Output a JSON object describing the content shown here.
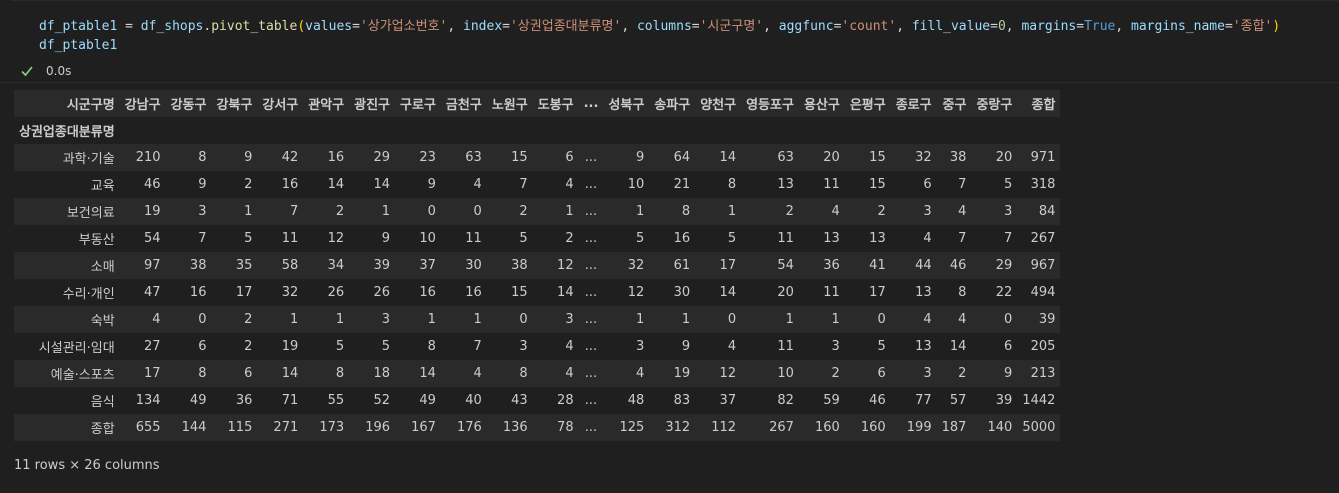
{
  "code": {
    "line1_var": "df_ptable1",
    "line1_assign": " = ",
    "line1_obj": "df_shops",
    "line1_method": ".pivot_table",
    "line1_open": "(",
    "arg_values_key": "values",
    "arg_values_val": "'상가업소번호'",
    "arg_index_key": "index",
    "arg_index_val": "'상권업종대분류명'",
    "arg_columns_key": "columns",
    "arg_columns_val": "'시군구명'",
    "arg_aggfunc_key": "aggfunc",
    "arg_aggfunc_val": "'count'",
    "arg_fill_key": "fill_value",
    "arg_fill_val": "0",
    "arg_margins_key": "margins",
    "arg_margins_val": "True",
    "arg_mname_key": "margins_name",
    "arg_mname_val": "'종합'",
    "line1_close": ")",
    "line2": "df_ptable1"
  },
  "exec": {
    "time": "0.0s",
    "status_color": "#89d185"
  },
  "table": {
    "columns_name": "시군구명",
    "index_name": "상권업종대분류명",
    "columns": [
      "강남구",
      "강동구",
      "강북구",
      "강서구",
      "관악구",
      "광진구",
      "구로구",
      "금천구",
      "노원구",
      "도봉구",
      "...",
      "성북구",
      "송파구",
      "양천구",
      "영등포구",
      "용산구",
      "은평구",
      "종로구",
      "중구",
      "중랑구",
      "종합"
    ],
    "rows": [
      {
        "label": "과학·기술",
        "values": [
          "210",
          "8",
          "9",
          "42",
          "16",
          "29",
          "23",
          "63",
          "15",
          "6",
          "...",
          "9",
          "64",
          "14",
          "63",
          "20",
          "15",
          "32",
          "38",
          "20",
          "971"
        ]
      },
      {
        "label": "교육",
        "values": [
          "46",
          "9",
          "2",
          "16",
          "14",
          "14",
          "9",
          "4",
          "7",
          "4",
          "...",
          "10",
          "21",
          "8",
          "13",
          "11",
          "15",
          "6",
          "7",
          "5",
          "318"
        ]
      },
      {
        "label": "보건의료",
        "values": [
          "19",
          "3",
          "1",
          "7",
          "2",
          "1",
          "0",
          "0",
          "2",
          "1",
          "...",
          "1",
          "8",
          "1",
          "2",
          "4",
          "2",
          "3",
          "4",
          "3",
          "84"
        ]
      },
      {
        "label": "부동산",
        "values": [
          "54",
          "7",
          "5",
          "11",
          "12",
          "9",
          "10",
          "11",
          "5",
          "2",
          "...",
          "5",
          "16",
          "5",
          "11",
          "13",
          "13",
          "4",
          "7",
          "7",
          "267"
        ]
      },
      {
        "label": "소매",
        "values": [
          "97",
          "38",
          "35",
          "58",
          "34",
          "39",
          "37",
          "30",
          "38",
          "12",
          "...",
          "32",
          "61",
          "17",
          "54",
          "36",
          "41",
          "44",
          "46",
          "29",
          "967"
        ]
      },
      {
        "label": "수리·개인",
        "values": [
          "47",
          "16",
          "17",
          "32",
          "26",
          "26",
          "16",
          "16",
          "15",
          "14",
          "...",
          "12",
          "30",
          "14",
          "20",
          "11",
          "17",
          "13",
          "8",
          "22",
          "494"
        ]
      },
      {
        "label": "숙박",
        "values": [
          "4",
          "0",
          "2",
          "1",
          "1",
          "3",
          "1",
          "1",
          "0",
          "3",
          "...",
          "1",
          "1",
          "0",
          "1",
          "1",
          "0",
          "4",
          "4",
          "0",
          "39"
        ]
      },
      {
        "label": "시설관리·임대",
        "values": [
          "27",
          "6",
          "2",
          "19",
          "5",
          "5",
          "8",
          "7",
          "3",
          "4",
          "...",
          "3",
          "9",
          "4",
          "11",
          "3",
          "5",
          "13",
          "14",
          "6",
          "205"
        ]
      },
      {
        "label": "예술·스포츠",
        "values": [
          "17",
          "8",
          "6",
          "14",
          "8",
          "18",
          "14",
          "4",
          "8",
          "4",
          "...",
          "4",
          "19",
          "12",
          "10",
          "2",
          "6",
          "3",
          "2",
          "9",
          "213"
        ]
      },
      {
        "label": "음식",
        "values": [
          "134",
          "49",
          "36",
          "71",
          "55",
          "52",
          "49",
          "40",
          "43",
          "28",
          "...",
          "48",
          "83",
          "37",
          "82",
          "59",
          "46",
          "77",
          "57",
          "39",
          "1442"
        ]
      },
      {
        "label": "종합",
        "values": [
          "655",
          "144",
          "115",
          "271",
          "173",
          "196",
          "167",
          "176",
          "136",
          "78",
          "...",
          "125",
          "312",
          "112",
          "267",
          "160",
          "160",
          "199",
          "187",
          "140",
          "5000"
        ]
      }
    ],
    "shape": "11 rows × 26 columns"
  }
}
